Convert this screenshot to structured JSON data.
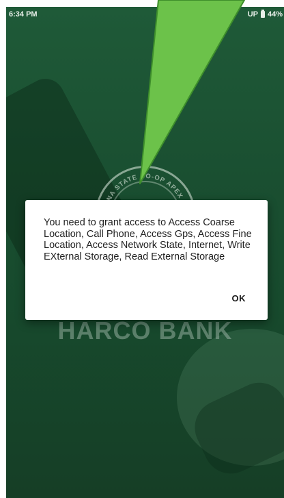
{
  "status_bar": {
    "time": "6:34 PM",
    "network": "UP",
    "battery": "44%"
  },
  "splash": {
    "logo_text": "ANA STATE CO-OP APEX B",
    "bank_name": "HARCO BANK",
    "background_color": "#1a4f31"
  },
  "dialog": {
    "message": "You need to grant access to Access Coarse Location, Call Phone, Access Gps, Access Fine Location, Access Network State, Internet, Write EXternal Storage, Read External Storage",
    "ok_label": "OK"
  },
  "annotation": {
    "arrow_color": "#6cc24a",
    "arrow_icon": "pointer-arrow"
  }
}
